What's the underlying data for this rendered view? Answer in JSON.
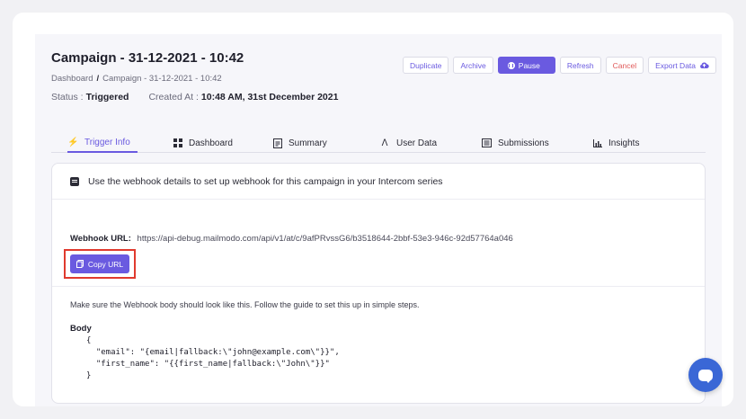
{
  "header": {
    "title": "Campaign - 31-12-2021 - 10:42",
    "breadcrumb": {
      "root": "Dashboard",
      "separator": "/",
      "current": "Campaign - 31-12-2021 - 10:42"
    },
    "status_label": "Status :",
    "status_value": "Triggered",
    "created_label": "Created At :",
    "created_value": "10:48 AM, 31st December 2021"
  },
  "actions": {
    "duplicate": "Duplicate",
    "archive": "Archive",
    "pause": "Pause",
    "refresh": "Refresh",
    "cancel": "Cancel",
    "export": "Export Data"
  },
  "tabs": [
    {
      "label": "Trigger Info",
      "icon": "bolt-icon",
      "active": true
    },
    {
      "label": "Dashboard",
      "icon": "grid-icon",
      "active": false
    },
    {
      "label": "Summary",
      "icon": "document-icon",
      "active": false
    },
    {
      "label": "User Data",
      "icon": "users-icon",
      "active": false
    },
    {
      "label": "Submissions",
      "icon": "list-icon",
      "active": false
    },
    {
      "label": "Insights",
      "icon": "bar-chart-icon",
      "active": false
    }
  ],
  "card": {
    "heading": "Use the webhook details to set up webhook for this campaign in your Intercom series",
    "webhook_label": "Webhook URL:",
    "webhook_url": "https://api-debug.mailmodo.com/api/v1/at/c/9afPRvssG6/b3518644-2bbf-53e3-946c-92d57764a046",
    "copy_button": "Copy URL",
    "info_text": "Make sure the Webhook body should look like this. Follow the guide to set this up in simple steps.",
    "body_label": "Body",
    "body_code": "{\n  \"email\": \"{email|fallback:\\\"john@example.com\\\"}}\",\n  \"first_name\": \"{{first_name|fallback:\\\"John\\\"}}\"\n}"
  },
  "colors": {
    "accent": "#6a5ae0",
    "danger": "#e05a5a",
    "highlight": "#e03a2e",
    "chat": "#3a67d6"
  }
}
